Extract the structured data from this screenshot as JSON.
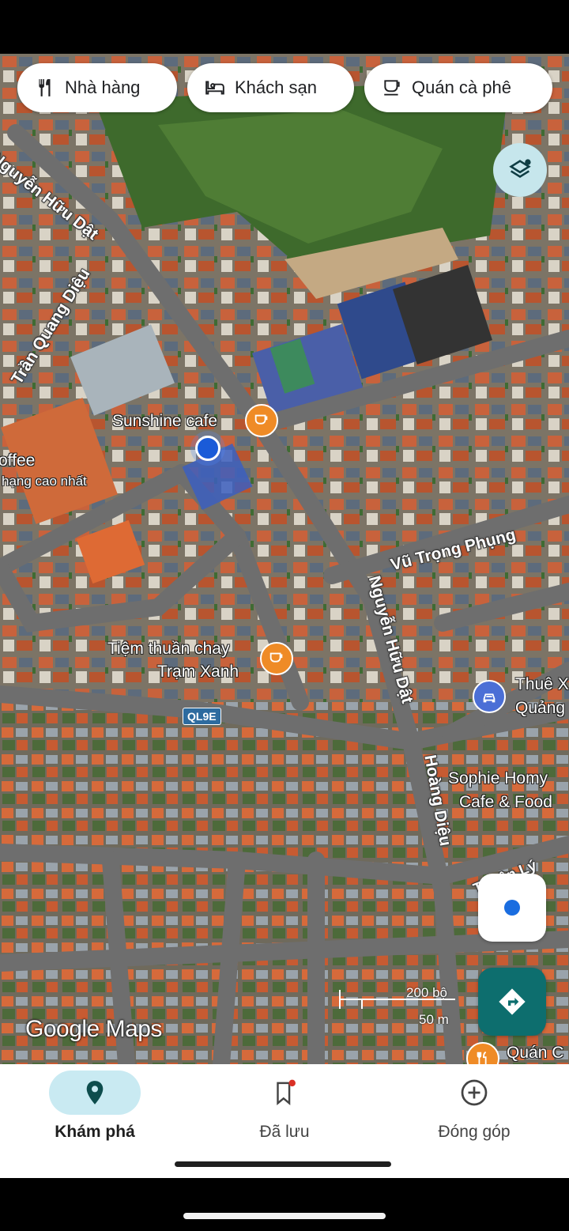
{
  "chips": [
    {
      "label": "Nhà hàng",
      "icon": "restaurant-icon"
    },
    {
      "label": "Khách sạn",
      "icon": "hotel-icon"
    },
    {
      "label": "Quán cà phê",
      "icon": "coffee-icon"
    }
  ],
  "roads": {
    "nguyen_huu_dat_top": "Nguyễn Hữu Dật",
    "tran_quang_dieu": "Trần Quang Diệu",
    "vu_trong_phung": "Vũ Trọng Phụng",
    "nguyen_huu_dat": "Nguyễn Hữu Dật",
    "hoang_dieu": "Hoàng Diệu",
    "thuan_ly": "Thuận Lý",
    "route_shield": "QL9E"
  },
  "pois": {
    "sunshine": "Sunshine cafe",
    "coffee_partial": "offee",
    "rating_partial": "hạng cao nhất",
    "tiem_line1": "Tiệm thuần chay",
    "tiem_line2": "Trạm Xanh",
    "thue_line1": "Thuê X",
    "thue_line2": "Quảng",
    "sophie_line1": "Sophie Homy",
    "sophie_line2": "Cafe & Food",
    "quan_partial": "Quán C"
  },
  "scale": {
    "imperial": "200 bộ",
    "metric": "50 m"
  },
  "watermark": "Google Maps",
  "nav": [
    {
      "label": "Khám phá",
      "icon": "explore-pin-icon",
      "active": true
    },
    {
      "label": "Đã lưu",
      "icon": "saved-bookmark-icon",
      "active": false
    },
    {
      "label": "Đóng góp",
      "icon": "contribute-plus-icon",
      "active": false
    }
  ],
  "colors": {
    "accent": "#0d6e6e",
    "poi_cafe": "#ef8b26",
    "nav_active_bg": "#c9eaf2",
    "location_dot": "#1a5bd8"
  }
}
